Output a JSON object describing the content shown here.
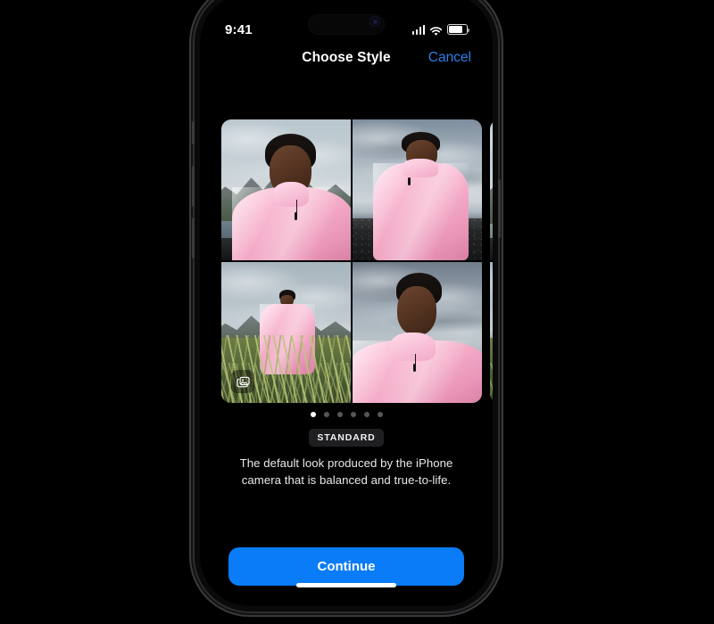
{
  "status_bar": {
    "time": "9:41",
    "cellular_icon": "cellular-bars-icon",
    "wifi_icon": "wifi-icon",
    "battery_icon": "battery-icon",
    "battery_level": 82
  },
  "nav": {
    "title": "Choose Style",
    "cancel_label": "Cancel",
    "cancel_color": "#2f7fe8"
  },
  "carousel": {
    "duplicate_badge_icon": "photo-stack-icon",
    "current_index": 0,
    "total": 6,
    "cards": [
      {
        "name": "standard-style-card",
        "photos": [
          {
            "name": "photo-portrait-mountains",
            "alt": "Close-up selfie in pink jacket with mountains behind"
          },
          {
            "name": "photo-black-beach",
            "alt": "Three-quarter view in pink jacket on black sand beach"
          },
          {
            "name": "photo-grass-field",
            "alt": "Full body in pink outfit standing in tall grass with mountains"
          },
          {
            "name": "photo-portrait-sky",
            "alt": "Head and shoulders portrait in pink jacket against cloudy sky"
          }
        ]
      },
      {
        "name": "next-style-card",
        "photos": [
          {
            "name": "photo-portrait-mountains",
            "alt": "Next style preview top left"
          },
          {
            "name": "photo-black-beach",
            "alt": "Next style preview top right"
          },
          {
            "name": "photo-grass-field",
            "alt": "Next style preview bottom left"
          },
          {
            "name": "photo-portrait-sky",
            "alt": "Next style preview bottom right"
          }
        ]
      }
    ]
  },
  "style": {
    "badge_label": "STANDARD",
    "description": "The default look produced by the iPhone camera that is balanced and true-to-life."
  },
  "footer": {
    "continue_label": "Continue",
    "continue_color": "#0a7cf8",
    "home_indicator": "home-indicator"
  }
}
